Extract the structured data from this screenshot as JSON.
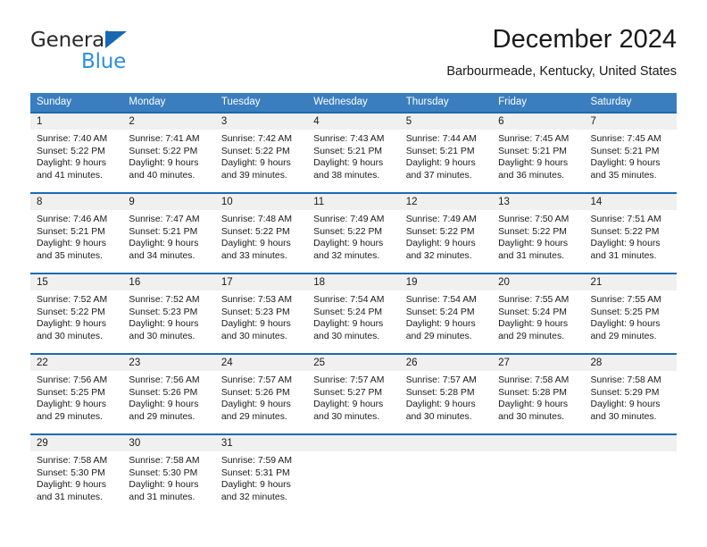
{
  "brand": {
    "name_top": "General",
    "name_bottom": "Blue",
    "color_dark": "#2b2b2b",
    "color_blue": "#2a8fe0",
    "triangle_color": "#1668b3"
  },
  "header": {
    "title": "December 2024",
    "subtitle": "Barbourmeade, Kentucky, United States"
  },
  "theme": {
    "header_bg": "#3a7ebf",
    "header_text": "#ffffff",
    "row_divider": "#1a6bb0",
    "day_band_bg": "#f0f0f0",
    "body_text": "#1a1a1a"
  },
  "calendar": {
    "weekdays": [
      "Sunday",
      "Monday",
      "Tuesday",
      "Wednesday",
      "Thursday",
      "Friday",
      "Saturday"
    ],
    "weeks": [
      [
        {
          "day": "1",
          "sunrise": "Sunrise: 7:40 AM",
          "sunset": "Sunset: 5:22 PM",
          "daylight1": "Daylight: 9 hours",
          "daylight2": "and 41 minutes."
        },
        {
          "day": "2",
          "sunrise": "Sunrise: 7:41 AM",
          "sunset": "Sunset: 5:22 PM",
          "daylight1": "Daylight: 9 hours",
          "daylight2": "and 40 minutes."
        },
        {
          "day": "3",
          "sunrise": "Sunrise: 7:42 AM",
          "sunset": "Sunset: 5:22 PM",
          "daylight1": "Daylight: 9 hours",
          "daylight2": "and 39 minutes."
        },
        {
          "day": "4",
          "sunrise": "Sunrise: 7:43 AM",
          "sunset": "Sunset: 5:21 PM",
          "daylight1": "Daylight: 9 hours",
          "daylight2": "and 38 minutes."
        },
        {
          "day": "5",
          "sunrise": "Sunrise: 7:44 AM",
          "sunset": "Sunset: 5:21 PM",
          "daylight1": "Daylight: 9 hours",
          "daylight2": "and 37 minutes."
        },
        {
          "day": "6",
          "sunrise": "Sunrise: 7:45 AM",
          "sunset": "Sunset: 5:21 PM",
          "daylight1": "Daylight: 9 hours",
          "daylight2": "and 36 minutes."
        },
        {
          "day": "7",
          "sunrise": "Sunrise: 7:45 AM",
          "sunset": "Sunset: 5:21 PM",
          "daylight1": "Daylight: 9 hours",
          "daylight2": "and 35 minutes."
        }
      ],
      [
        {
          "day": "8",
          "sunrise": "Sunrise: 7:46 AM",
          "sunset": "Sunset: 5:21 PM",
          "daylight1": "Daylight: 9 hours",
          "daylight2": "and 35 minutes."
        },
        {
          "day": "9",
          "sunrise": "Sunrise: 7:47 AM",
          "sunset": "Sunset: 5:21 PM",
          "daylight1": "Daylight: 9 hours",
          "daylight2": "and 34 minutes."
        },
        {
          "day": "10",
          "sunrise": "Sunrise: 7:48 AM",
          "sunset": "Sunset: 5:22 PM",
          "daylight1": "Daylight: 9 hours",
          "daylight2": "and 33 minutes."
        },
        {
          "day": "11",
          "sunrise": "Sunrise: 7:49 AM",
          "sunset": "Sunset: 5:22 PM",
          "daylight1": "Daylight: 9 hours",
          "daylight2": "and 32 minutes."
        },
        {
          "day": "12",
          "sunrise": "Sunrise: 7:49 AM",
          "sunset": "Sunset: 5:22 PM",
          "daylight1": "Daylight: 9 hours",
          "daylight2": "and 32 minutes."
        },
        {
          "day": "13",
          "sunrise": "Sunrise: 7:50 AM",
          "sunset": "Sunset: 5:22 PM",
          "daylight1": "Daylight: 9 hours",
          "daylight2": "and 31 minutes."
        },
        {
          "day": "14",
          "sunrise": "Sunrise: 7:51 AM",
          "sunset": "Sunset: 5:22 PM",
          "daylight1": "Daylight: 9 hours",
          "daylight2": "and 31 minutes."
        }
      ],
      [
        {
          "day": "15",
          "sunrise": "Sunrise: 7:52 AM",
          "sunset": "Sunset: 5:22 PM",
          "daylight1": "Daylight: 9 hours",
          "daylight2": "and 30 minutes."
        },
        {
          "day": "16",
          "sunrise": "Sunrise: 7:52 AM",
          "sunset": "Sunset: 5:23 PM",
          "daylight1": "Daylight: 9 hours",
          "daylight2": "and 30 minutes."
        },
        {
          "day": "17",
          "sunrise": "Sunrise: 7:53 AM",
          "sunset": "Sunset: 5:23 PM",
          "daylight1": "Daylight: 9 hours",
          "daylight2": "and 30 minutes."
        },
        {
          "day": "18",
          "sunrise": "Sunrise: 7:54 AM",
          "sunset": "Sunset: 5:24 PM",
          "daylight1": "Daylight: 9 hours",
          "daylight2": "and 30 minutes."
        },
        {
          "day": "19",
          "sunrise": "Sunrise: 7:54 AM",
          "sunset": "Sunset: 5:24 PM",
          "daylight1": "Daylight: 9 hours",
          "daylight2": "and 29 minutes."
        },
        {
          "day": "20",
          "sunrise": "Sunrise: 7:55 AM",
          "sunset": "Sunset: 5:24 PM",
          "daylight1": "Daylight: 9 hours",
          "daylight2": "and 29 minutes."
        },
        {
          "day": "21",
          "sunrise": "Sunrise: 7:55 AM",
          "sunset": "Sunset: 5:25 PM",
          "daylight1": "Daylight: 9 hours",
          "daylight2": "and 29 minutes."
        }
      ],
      [
        {
          "day": "22",
          "sunrise": "Sunrise: 7:56 AM",
          "sunset": "Sunset: 5:25 PM",
          "daylight1": "Daylight: 9 hours",
          "daylight2": "and 29 minutes."
        },
        {
          "day": "23",
          "sunrise": "Sunrise: 7:56 AM",
          "sunset": "Sunset: 5:26 PM",
          "daylight1": "Daylight: 9 hours",
          "daylight2": "and 29 minutes."
        },
        {
          "day": "24",
          "sunrise": "Sunrise: 7:57 AM",
          "sunset": "Sunset: 5:26 PM",
          "daylight1": "Daylight: 9 hours",
          "daylight2": "and 29 minutes."
        },
        {
          "day": "25",
          "sunrise": "Sunrise: 7:57 AM",
          "sunset": "Sunset: 5:27 PM",
          "daylight1": "Daylight: 9 hours",
          "daylight2": "and 30 minutes."
        },
        {
          "day": "26",
          "sunrise": "Sunrise: 7:57 AM",
          "sunset": "Sunset: 5:28 PM",
          "daylight1": "Daylight: 9 hours",
          "daylight2": "and 30 minutes."
        },
        {
          "day": "27",
          "sunrise": "Sunrise: 7:58 AM",
          "sunset": "Sunset: 5:28 PM",
          "daylight1": "Daylight: 9 hours",
          "daylight2": "and 30 minutes."
        },
        {
          "day": "28",
          "sunrise": "Sunrise: 7:58 AM",
          "sunset": "Sunset: 5:29 PM",
          "daylight1": "Daylight: 9 hours",
          "daylight2": "and 30 minutes."
        }
      ],
      [
        {
          "day": "29",
          "sunrise": "Sunrise: 7:58 AM",
          "sunset": "Sunset: 5:30 PM",
          "daylight1": "Daylight: 9 hours",
          "daylight2": "and 31 minutes."
        },
        {
          "day": "30",
          "sunrise": "Sunrise: 7:58 AM",
          "sunset": "Sunset: 5:30 PM",
          "daylight1": "Daylight: 9 hours",
          "daylight2": "and 31 minutes."
        },
        {
          "day": "31",
          "sunrise": "Sunrise: 7:59 AM",
          "sunset": "Sunset: 5:31 PM",
          "daylight1": "Daylight: 9 hours",
          "daylight2": "and 32 minutes."
        },
        {
          "day": "",
          "sunrise": "",
          "sunset": "",
          "daylight1": "",
          "daylight2": ""
        },
        {
          "day": "",
          "sunrise": "",
          "sunset": "",
          "daylight1": "",
          "daylight2": ""
        },
        {
          "day": "",
          "sunrise": "",
          "sunset": "",
          "daylight1": "",
          "daylight2": ""
        },
        {
          "day": "",
          "sunrise": "",
          "sunset": "",
          "daylight1": "",
          "daylight2": ""
        }
      ]
    ]
  }
}
